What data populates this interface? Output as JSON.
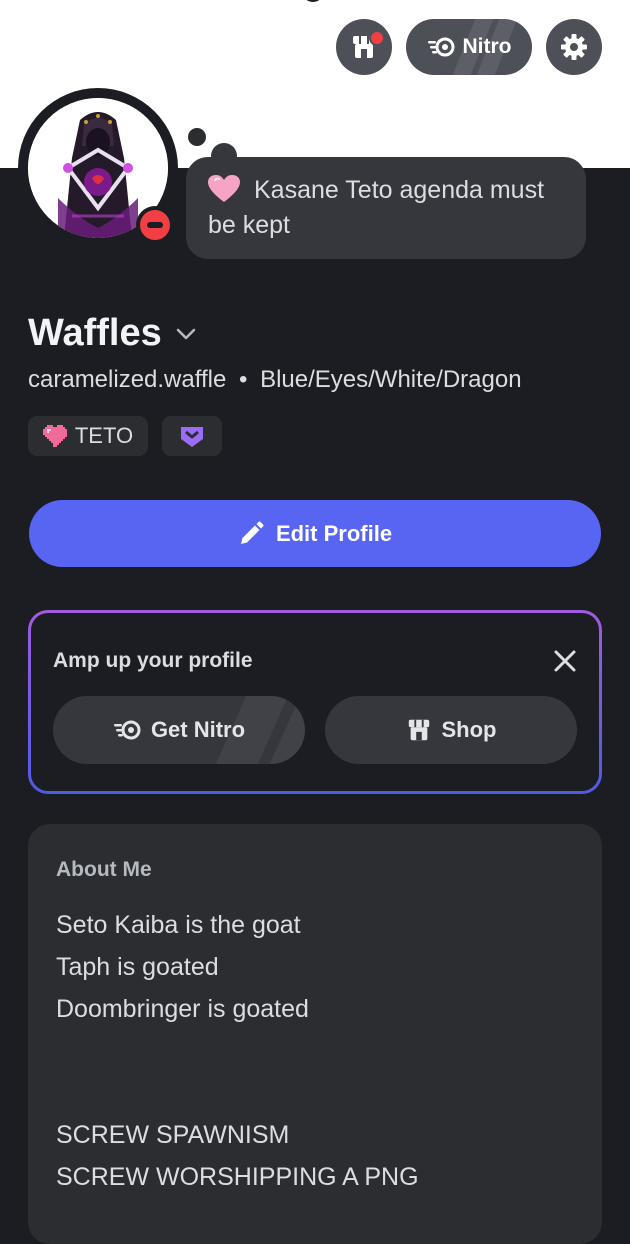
{
  "header": {
    "shop_icon": "shop-icon",
    "nitro_label": "Nitro",
    "nitro_icon": "nitro-icon",
    "settings_icon": "gear-icon"
  },
  "profile": {
    "status_emoji": "pink-heart-emoji",
    "custom_status": "Kasane Teto agenda must be kept",
    "display_name": "Waffles",
    "username": "caramelized.waffle",
    "separator": "•",
    "pronouns": "Blue/Eyes/White/Dragon",
    "tags": [
      {
        "label": "TETO",
        "icon": "pixel-heart-icon"
      },
      {
        "label": "",
        "icon": "purple-badge-icon"
      }
    ],
    "edit_profile_label": "Edit Profile",
    "presence": "do-not-disturb",
    "presence_color": "#f23f43"
  },
  "promo": {
    "title": "Amp up your profile",
    "get_nitro_label": "Get Nitro",
    "shop_label": "Shop"
  },
  "about": {
    "title": "About Me",
    "lines": [
      "Seto Kaiba is the goat",
      "Taph is goated",
      "Doombringer is goated",
      "",
      "",
      "SCREW SPAWNISM",
      "SCREW WORSHIPPING A PNG"
    ]
  },
  "colors": {
    "background": "#1c1d22",
    "accent": "#5865f2",
    "card": "#2b2d31",
    "pill": "#35373d",
    "dnd_red": "#f23f43"
  }
}
